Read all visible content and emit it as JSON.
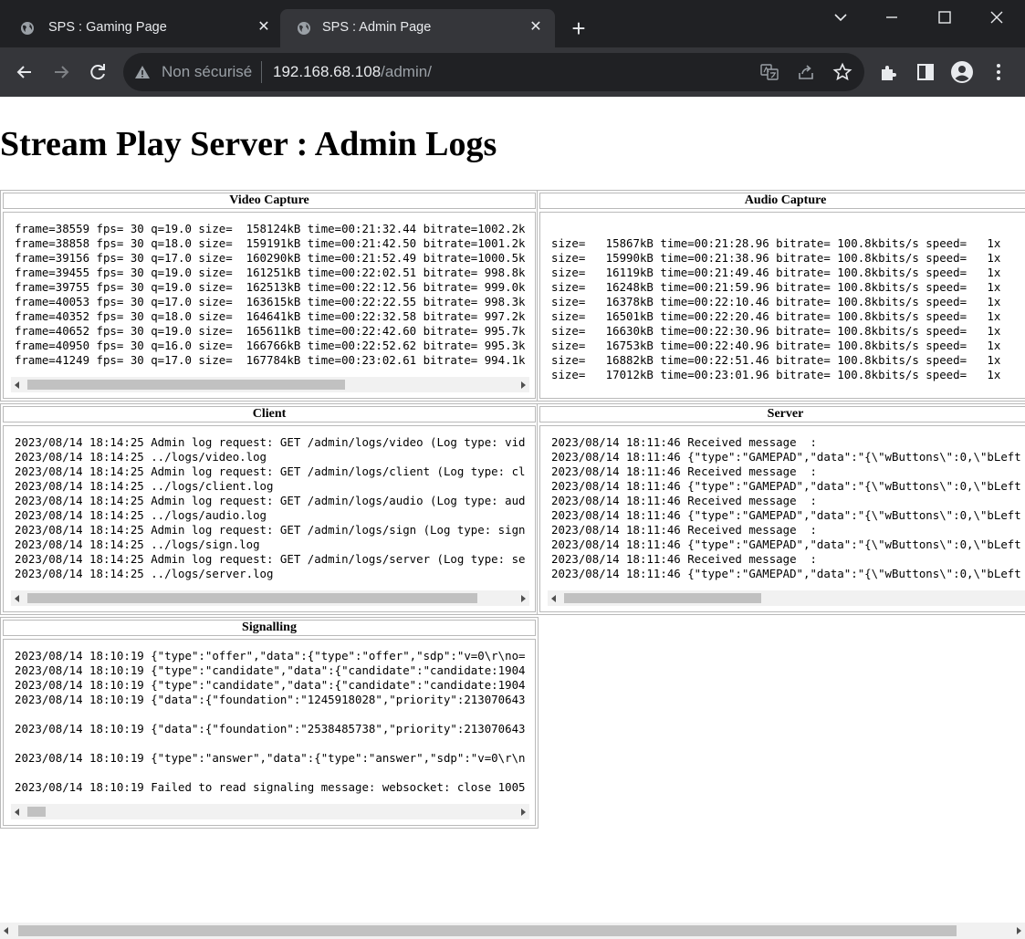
{
  "browser": {
    "tabs": [
      {
        "title": "SPS : Gaming Page"
      },
      {
        "title": "SPS : Admin Page"
      }
    ],
    "security_label": "Non sécurisé",
    "url_host": "192.168.68.108",
    "url_path": "/admin/"
  },
  "page": {
    "title": "Stream Play Server : Admin Logs"
  },
  "panels": {
    "video": {
      "title": "Video Capture",
      "lines": [
        "frame=38559 fps= 30 q=19.0 size=  158124kB time=00:21:32.44 bitrate=1002.2k",
        "frame=38858 fps= 30 q=18.0 size=  159191kB time=00:21:42.50 bitrate=1001.2k",
        "frame=39156 fps= 30 q=17.0 size=  160290kB time=00:21:52.49 bitrate=1000.5k",
        "frame=39455 fps= 30 q=19.0 size=  161251kB time=00:22:02.51 bitrate= 998.8k",
        "frame=39755 fps= 30 q=19.0 size=  162513kB time=00:22:12.56 bitrate= 999.0k",
        "frame=40053 fps= 30 q=17.0 size=  163615kB time=00:22:22.55 bitrate= 998.3k",
        "frame=40352 fps= 30 q=18.0 size=  164641kB time=00:22:32.58 bitrate= 997.2k",
        "frame=40652 fps= 30 q=19.0 size=  165611kB time=00:22:42.60 bitrate= 995.7k",
        "frame=40950 fps= 30 q=16.0 size=  166766kB time=00:22:52.62 bitrate= 995.3k",
        "frame=41249 fps= 30 q=17.0 size=  167784kB time=00:23:02.61 bitrate= 994.1k"
      ]
    },
    "audio": {
      "title": "Audio Capture",
      "lines": [
        "size=   15867kB time=00:21:28.96 bitrate= 100.8kbits/s speed=   1x",
        "size=   15990kB time=00:21:38.96 bitrate= 100.8kbits/s speed=   1x",
        "size=   16119kB time=00:21:49.46 bitrate= 100.8kbits/s speed=   1x",
        "size=   16248kB time=00:21:59.96 bitrate= 100.8kbits/s speed=   1x",
        "size=   16378kB time=00:22:10.46 bitrate= 100.8kbits/s speed=   1x",
        "size=   16501kB time=00:22:20.46 bitrate= 100.8kbits/s speed=   1x",
        "size=   16630kB time=00:22:30.96 bitrate= 100.8kbits/s speed=   1x",
        "size=   16753kB time=00:22:40.96 bitrate= 100.8kbits/s speed=   1x",
        "size=   16882kB time=00:22:51.46 bitrate= 100.8kbits/s speed=   1x",
        "size=   17012kB time=00:23:01.96 bitrate= 100.8kbits/s speed=   1x"
      ]
    },
    "client": {
      "title": "Client",
      "lines": [
        "2023/08/14 18:14:25 Admin log request: GET /admin/logs/video (Log type: vid",
        "2023/08/14 18:14:25 ../logs/video.log",
        "2023/08/14 18:14:25 Admin log request: GET /admin/logs/client (Log type: cl",
        "2023/08/14 18:14:25 ../logs/client.log",
        "2023/08/14 18:14:25 Admin log request: GET /admin/logs/audio (Log type: aud",
        "2023/08/14 18:14:25 ../logs/audio.log",
        "2023/08/14 18:14:25 Admin log request: GET /admin/logs/sign (Log type: sign",
        "2023/08/14 18:14:25 ../logs/sign.log",
        "2023/08/14 18:14:25 Admin log request: GET /admin/logs/server (Log type: se",
        "2023/08/14 18:14:25 ../logs/server.log"
      ]
    },
    "server": {
      "title": "Server",
      "lines": [
        "2023/08/14 18:11:46 Received message  :",
        "2023/08/14 18:11:46 {\"type\":\"GAMEPAD\",\"data\":\"{\\\"wButtons\\\":0,\\\"bLeft",
        "2023/08/14 18:11:46 Received message  :",
        "2023/08/14 18:11:46 {\"type\":\"GAMEPAD\",\"data\":\"{\\\"wButtons\\\":0,\\\"bLeft",
        "2023/08/14 18:11:46 Received message  :",
        "2023/08/14 18:11:46 {\"type\":\"GAMEPAD\",\"data\":\"{\\\"wButtons\\\":0,\\\"bLeft",
        "2023/08/14 18:11:46 Received message  :",
        "2023/08/14 18:11:46 {\"type\":\"GAMEPAD\",\"data\":\"{\\\"wButtons\\\":0,\\\"bLeft",
        "2023/08/14 18:11:46 Received message  :",
        "2023/08/14 18:11:46 {\"type\":\"GAMEPAD\",\"data\":\"{\\\"wButtons\\\":0,\\\"bLeft"
      ]
    },
    "signalling": {
      "title": "Signalling",
      "lines": [
        "2023/08/14 18:10:19 {\"type\":\"offer\",\"data\":{\"type\":\"offer\",\"sdp\":\"v=0\\r\\no=",
        "2023/08/14 18:10:19 {\"type\":\"candidate\",\"data\":{\"candidate\":\"candidate:1904",
        "2023/08/14 18:10:19 {\"type\":\"candidate\",\"data\":{\"candidate\":\"candidate:1904",
        "2023/08/14 18:10:19 {\"data\":{\"foundation\":\"1245918028\",\"priority\":213070643",
        "",
        "2023/08/14 18:10:19 {\"data\":{\"foundation\":\"2538485738\",\"priority\":213070643",
        "",
        "2023/08/14 18:10:19 {\"type\":\"answer\",\"data\":{\"type\":\"answer\",\"sdp\":\"v=0\\r\\n",
        "",
        "2023/08/14 18:10:19 Failed to read signaling message: websocket: close 1005"
      ]
    }
  }
}
